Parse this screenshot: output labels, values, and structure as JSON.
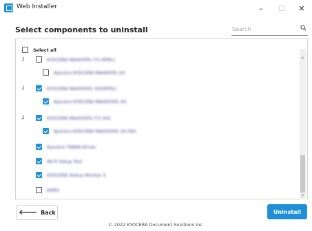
{
  "window": {
    "title": "Web Installer",
    "minimize_glyph": "–",
    "maximize_glyph": "☐",
    "close_glyph": "✕"
  },
  "header": {
    "title": "Select components to uninstall",
    "search_placeholder": "Search"
  },
  "components": {
    "select_all_label": "Select all",
    "items": [
      {
        "label": "KYOCERA MA4000fx (Y1 KPDL)",
        "checked": false,
        "indent": 1,
        "collapse": true,
        "blurred": true
      },
      {
        "label": "Kyocera KYOCERA MA4000fx XX",
        "checked": false,
        "indent": 2,
        "collapse": false,
        "blurred": true
      },
      {
        "label": "KYOCERA MA4000ifx (KX/KPDL)",
        "checked": true,
        "indent": 1,
        "collapse": true,
        "blurred": true
      },
      {
        "label": "Kyocera KYOCERA MA4000ifx XX",
        "checked": true,
        "indent": 2,
        "collapse": false,
        "blurred": true
      },
      {
        "label": "KYOCERA MA4500ifx (Y1 KX)",
        "checked": true,
        "indent": 1,
        "collapse": true,
        "blurred": true
      },
      {
        "label": "Kyocera KYOCERA MA4500ifx XX FAX",
        "checked": true,
        "indent": 2,
        "collapse": false,
        "blurred": true
      },
      {
        "label": "Kyocera TWAIN Driver",
        "checked": true,
        "indent": 1,
        "collapse": false,
        "blurred": true
      },
      {
        "label": "Wi-Fi Setup Tool",
        "checked": true,
        "indent": 1,
        "collapse": false,
        "blurred": true
      },
      {
        "label": "KYOCERA Status Monitor 5",
        "checked": true,
        "indent": 1,
        "collapse": false,
        "blurred": true
      },
      {
        "label": "KMPS",
        "checked": false,
        "indent": 1,
        "collapse": false,
        "blurred": true
      }
    ]
  },
  "buttons": {
    "back_label": "Back",
    "back_glyph": "🡐",
    "uninstall_label": "Uninstall"
  },
  "scrollbar": {
    "up_glyph": "▲",
    "down_glyph": "▼"
  },
  "footer": {
    "copyright": "© 2022 KYOCERA Document Solutions Inc."
  },
  "colors": {
    "accent": "#1f8fd6"
  }
}
